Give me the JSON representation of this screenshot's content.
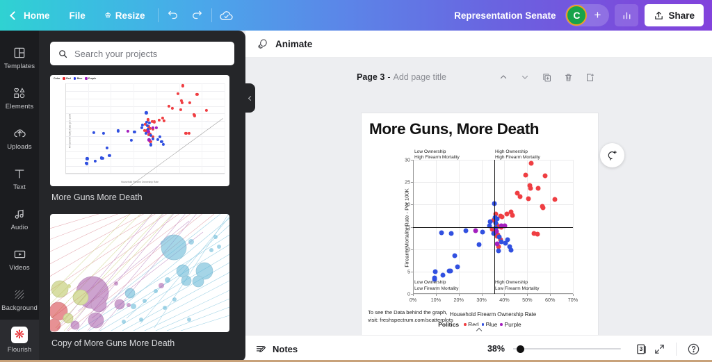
{
  "topbar": {
    "back_label": "Home",
    "file_label": "File",
    "resize_label": "Resize",
    "undo_icon": "undo-icon",
    "redo_icon": "redo-icon",
    "cloud_icon": "cloud-saved-icon",
    "doc_title": "Representation Senate",
    "avatar_initial": "C",
    "add_collaborator": "+",
    "stats_icon": "bar-chart-icon",
    "share_label": "Share",
    "accent_green": "#17a34a",
    "accent_ring": "#f0a020"
  },
  "rail": {
    "items": [
      {
        "label": "Templates",
        "icon": "templates-icon"
      },
      {
        "label": "Elements",
        "icon": "elements-icon"
      },
      {
        "label": "Uploads",
        "icon": "uploads-icon"
      },
      {
        "label": "Text",
        "icon": "text-icon"
      },
      {
        "label": "Audio",
        "icon": "audio-icon"
      },
      {
        "label": "Videos",
        "icon": "videos-icon"
      },
      {
        "label": "Background",
        "icon": "background-icon"
      },
      {
        "label": "Flourish",
        "icon": "flourish-icon"
      }
    ]
  },
  "panel": {
    "search": {
      "value": "",
      "placeholder": "Search your projects",
      "icon": "search-icon"
    },
    "projects": [
      {
        "label": "More Guns More Death",
        "type": "scatter-thumbnail"
      },
      {
        "label": "Copy of More Guns More Death",
        "type": "bubble-thumbnail"
      }
    ],
    "thumb_legend": {
      "title": "Color",
      "items": [
        {
          "label": "Red",
          "color": "#e8252a"
        },
        {
          "label": "Blue",
          "color": "#2335e8"
        },
        {
          "label": "Purple",
          "color": "#a41fbe"
        }
      ]
    },
    "thumb_axis": {
      "x_title": "Household Firearm Ownership Rate",
      "y_title": "Firearm Mortality Rate (per 100K)"
    },
    "collapse_icon": "chevron-left-icon"
  },
  "editor": {
    "animate_label": "Animate",
    "animate_icon": "animate-icon",
    "page_number_label": "Page 3",
    "page_dash": "-",
    "page_title_placeholder": "Add page title",
    "tools": [
      {
        "icon": "chevron-up-icon",
        "name": "move-page-up"
      },
      {
        "icon": "chevron-down-icon",
        "name": "move-page-down"
      },
      {
        "icon": "duplicate-icon",
        "name": "duplicate-page"
      },
      {
        "icon": "trash-icon",
        "name": "delete-page"
      },
      {
        "icon": "add-page-icon",
        "name": "add-page"
      }
    ],
    "comment_icon": "add-comment-icon"
  },
  "slide": {
    "title": "More Guns, More Death",
    "caption": "To see the Data behind the graph,\nvisit: freshspectrum.com/scatterplots"
  },
  "bottombar": {
    "notes_label": "Notes",
    "notes_icon": "notes-icon",
    "zoom_percent": "38%",
    "pages_count": "3",
    "pages_icon": "pages-icon",
    "fullscreen_icon": "fullscreen-icon",
    "help_icon": "help-icon",
    "collapse_icon": "chevron-up-icon"
  },
  "chart_data": {
    "type": "scatter",
    "title": "More Guns, More Death",
    "xlabel": "Household Firearm Ownership Rate",
    "ylabel": "Firearm Mortality Rate - Per 100K",
    "xlim": [
      0,
      70
    ],
    "ylim": [
      0,
      30
    ],
    "xticks": [
      "0%",
      "10%",
      "20%",
      "30%",
      "40%",
      "50%",
      "60%",
      "70%"
    ],
    "xtick_values": [
      0,
      10,
      20,
      30,
      40,
      50,
      60,
      70
    ],
    "yticks": [
      "0",
      "5",
      "10",
      "15",
      "20",
      "25",
      "30"
    ],
    "ytick_values": [
      0,
      5,
      10,
      15,
      20,
      25,
      30
    ],
    "grid": true,
    "legend_title": "Politics",
    "legend_position": "bottom-center",
    "reference_lines": {
      "horizontal_y": 15,
      "vertical_x": 35.5
    },
    "quadrant_labels": {
      "top_left": "Low Ownership\nHigh Firearm Mortality",
      "top_right": "High Ownership\nHigh Firearm Mortality",
      "bottom_left": "Low Ownership\nLow Firearm Mortality",
      "bottom_right": "High Ownership\nLow Firearm Mortality"
    },
    "series": [
      {
        "name": "Red",
        "color": "#ef3e42",
        "points": [
          [
            51.7,
            29.2
          ],
          [
            49.4,
            26.6
          ],
          [
            57.9,
            26.4
          ],
          [
            51.0,
            24.2
          ],
          [
            51.3,
            23.6
          ],
          [
            54.7,
            23.6
          ],
          [
            45.5,
            22.5
          ],
          [
            47.0,
            21.8
          ],
          [
            50.6,
            21.3
          ],
          [
            62.1,
            21.1
          ],
          [
            56.6,
            19.6
          ],
          [
            56.9,
            19.3
          ],
          [
            42.8,
            18.4
          ],
          [
            41.2,
            17.8
          ],
          [
            43.5,
            17.6
          ],
          [
            36.3,
            17.9
          ],
          [
            38.3,
            17.4
          ],
          [
            39.0,
            17.2
          ],
          [
            36.6,
            15.6
          ],
          [
            37.3,
            15.1
          ],
          [
            38.6,
            14.9
          ],
          [
            35.9,
            14.2
          ],
          [
            53.0,
            13.5
          ],
          [
            54.5,
            13.4
          ],
          [
            37.2,
            13.2
          ],
          [
            36.8,
            12.9
          ],
          [
            38.4,
            12.2
          ],
          [
            37.4,
            10.6
          ],
          [
            34.8,
            14.4
          ],
          [
            35.2,
            16.4
          ]
        ]
      },
      {
        "name": "Blue",
        "color": "#3150e0",
        "points": [
          [
            35.6,
            20.2
          ],
          [
            23.2,
            14.2
          ],
          [
            16.8,
            13.5
          ],
          [
            33.9,
            16.2
          ],
          [
            30.4,
            13.9
          ],
          [
            12.5,
            13.7
          ],
          [
            35.4,
            13.5
          ],
          [
            36.1,
            15.9
          ],
          [
            36.9,
            16.8
          ],
          [
            37.6,
            12.8
          ],
          [
            40.6,
            11.4
          ],
          [
            42.3,
            10.6
          ],
          [
            41.5,
            12.2
          ],
          [
            38.5,
            11.6
          ],
          [
            43.0,
            9.8
          ],
          [
            37.5,
            9.6
          ],
          [
            28.9,
            11.1
          ],
          [
            18.2,
            8.5
          ],
          [
            19.4,
            6.0
          ],
          [
            15.9,
            5.2
          ],
          [
            16.4,
            5.1
          ],
          [
            9.6,
            5.0
          ],
          [
            9.3,
            3.5
          ],
          [
            9.4,
            3.3
          ],
          [
            13.2,
            4.2
          ],
          [
            36.3,
            14.8
          ],
          [
            35.8,
            17.1
          ],
          [
            33.6,
            15.2
          ]
        ]
      },
      {
        "name": "Purple",
        "color": "#a41fbe",
        "points": [
          [
            27.5,
            14.1
          ],
          [
            38.6,
            15.2
          ],
          [
            36.5,
            14.0
          ],
          [
            36.8,
            11.2
          ],
          [
            40.1,
            15.3
          ]
        ]
      }
    ]
  }
}
